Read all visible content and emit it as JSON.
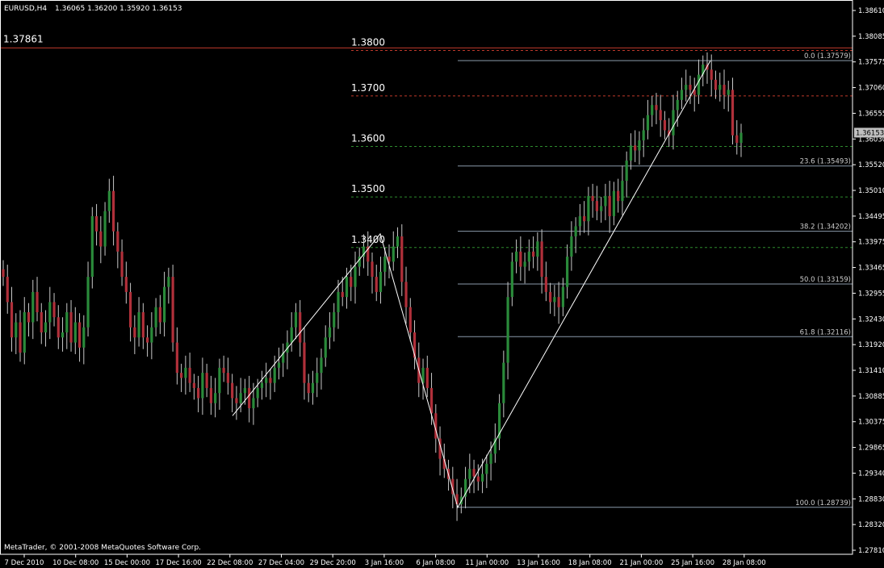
{
  "header": {
    "symbol": "EURUSD,H4",
    "ohlc": "1.36065 1.36200 1.35920 1.36153"
  },
  "footer": {
    "copyright": "MetaTrader, © 2001-2008 MetaQuotes Software Corp."
  },
  "colors": {
    "background": "#000000",
    "frame": "#ffffff",
    "bull_candle": "#2a8a3a",
    "bear_candle": "#b0303a",
    "wick": "#c8c8c8",
    "resistance_line": "#c0392b",
    "green_level": "#2e8b2e",
    "red_level": "#c0392b",
    "fib_line": "#8a9aaa",
    "trend_line": "#ffffff",
    "current_price_bg": "#c0c0c0"
  },
  "chart_data": {
    "type": "candlestick",
    "ylim": [
      1.2781,
      1.3865
    ],
    "y_ticks": [
      "1.38610",
      "1.38085",
      "1.37575",
      "1.37060",
      "1.36555",
      "1.36030",
      "1.35520",
      "1.35010",
      "1.34495",
      "1.33975",
      "1.33465",
      "1.32955",
      "1.32430",
      "1.31920",
      "1.31410",
      "1.30885",
      "1.30375",
      "1.29865",
      "1.29340",
      "1.28830",
      "1.28320",
      "1.27810"
    ],
    "x_ticks": [
      "7 Dec 2010",
      "10 Dec 08:00",
      "15 Dec 00:00",
      "17 Dec 16:00",
      "22 Dec 08:00",
      "27 Dec 04:00",
      "29 Dec 20:00",
      "3 Jan 16:00",
      "6 Jan 08:00",
      "11 Jan 00:00",
      "13 Jan 16:00",
      "18 Jan 08:00",
      "21 Jan 00:00",
      "25 Jan 16:00",
      "28 Jan 08:00"
    ],
    "current_price": "1.36153",
    "resistance": {
      "label": "1.37861",
      "value": 1.37861
    },
    "levels": [
      {
        "label": "1.3800",
        "value": 1.3786,
        "style": "red"
      },
      {
        "label": "1.3700",
        "value": 1.3696,
        "style": "red"
      },
      {
        "label": "1.3600",
        "value": 1.3596,
        "style": "green"
      },
      {
        "label": "1.3500",
        "value": 1.3496,
        "style": "green"
      },
      {
        "label": "1.3400",
        "value": 1.3396,
        "style": "green"
      }
    ],
    "fibonacci": [
      {
        "label": "0.0 (1.37579)",
        "value": 1.37579
      },
      {
        "label": "23.6 (1.35493)",
        "value": 1.35493
      },
      {
        "label": "38.2 (1.34202)",
        "value": 1.34202
      },
      {
        "label": "50.0 (1.33159)",
        "value": 1.33159
      },
      {
        "label": "61.8 (1.32116)",
        "value": 1.32116
      },
      {
        "label": "100.0 (1.28739)",
        "value": 1.28739
      }
    ],
    "zigzag": [
      {
        "time": "22 Dec 08:00",
        "price": 1.3055
      },
      {
        "time": "3 Jan 16:00",
        "price": 1.3415
      },
      {
        "time": "10 Jan 08:00",
        "price": 1.28739
      },
      {
        "time": "27 Jan 08:00",
        "price": 1.37579
      }
    ],
    "closes": [
      1.333,
      1.328,
      1.321,
      1.324,
      1.318,
      1.326,
      1.324,
      1.33,
      1.326,
      1.322,
      1.324,
      1.328,
      1.325,
      1.321,
      1.322,
      1.326,
      1.32,
      1.324,
      1.319,
      1.323,
      1.333,
      1.345,
      1.342,
      1.339,
      1.346,
      1.35,
      1.342,
      1.338,
      1.333,
      1.33,
      1.323,
      1.321,
      1.326,
      1.321,
      1.32,
      1.323,
      1.327,
      1.324,
      1.331,
      1.333,
      1.32,
      1.314,
      1.313,
      1.315,
      1.312,
      1.311,
      1.309,
      1.314,
      1.311,
      1.308,
      1.31,
      1.315,
      1.314,
      1.312,
      1.309,
      1.308,
      1.31,
      1.311,
      1.307,
      1.309,
      1.311,
      1.312,
      1.313,
      1.312,
      1.315,
      1.316,
      1.318,
      1.32,
      1.323,
      1.326,
      1.32,
      1.312,
      1.31,
      1.312,
      1.314,
      1.317,
      1.321,
      1.323,
      1.326,
      1.33,
      1.329,
      1.333,
      1.331,
      1.335,
      1.337,
      1.339,
      1.336,
      1.333,
      1.33,
      1.334,
      1.337,
      1.336,
      1.339,
      1.341,
      1.332,
      1.327,
      1.322,
      1.317,
      1.312,
      1.315,
      1.311,
      1.306,
      1.301,
      1.297,
      1.295,
      1.293,
      1.29,
      1.288,
      1.2895,
      1.293,
      1.295,
      1.2935,
      1.2925,
      1.294,
      1.296,
      1.298,
      1.301,
      1.308,
      1.316,
      1.329,
      1.336,
      1.338,
      1.335,
      1.336,
      1.338,
      1.337,
      1.34,
      1.333,
      1.33,
      1.328,
      1.329,
      1.327,
      1.331,
      1.337,
      1.341,
      1.343,
      1.345,
      1.344,
      1.349,
      1.348,
      1.346,
      1.347,
      1.349,
      1.345,
      1.35,
      1.348,
      1.352,
      1.356,
      1.359,
      1.358,
      1.36,
      1.362,
      1.365,
      1.367,
      1.366,
      1.364,
      1.362,
      1.361,
      1.366,
      1.368,
      1.37,
      1.371,
      1.37,
      1.369,
      1.373,
      1.375,
      1.374,
      1.372,
      1.37,
      1.371,
      1.369,
      1.37,
      1.361,
      1.3595,
      1.3615
    ],
    "annotation_box": {
      "label": "1.36153"
    }
  }
}
